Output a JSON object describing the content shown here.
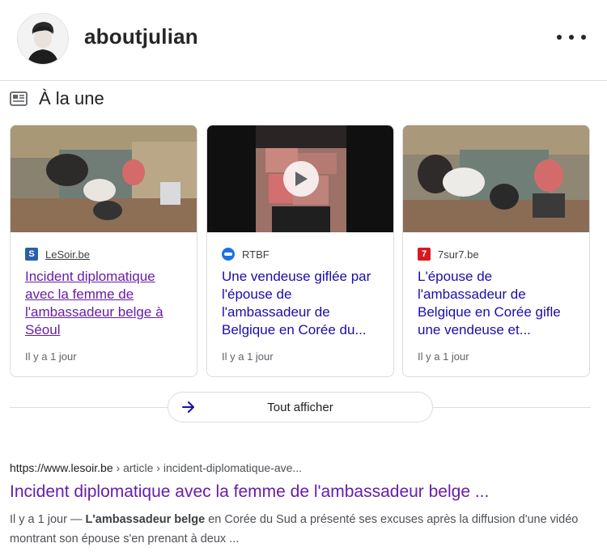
{
  "post": {
    "username": "aboutjulian",
    "avatar_icon": "person-avatar",
    "more_icon": "more-horizontal-icon"
  },
  "top_stories": {
    "title": "À la une",
    "icon": "newspaper-icon",
    "cards": [
      {
        "source": "LeSoir.be",
        "logo_letter": "S",
        "logo_color": "#2d5fa8",
        "headline": "Incident diplomatique avec la femme de l'ambassadeur belge à Séoul",
        "time": "Il y a 1 jour",
        "visited": true,
        "video": false
      },
      {
        "source": "RTBF",
        "logo_letter": "",
        "logo_color": "#1a73e8",
        "headline": "Une vendeuse giflée par l'épouse de l'ambassadeur de Belgique en Corée du...",
        "time": "Il y a 1 jour",
        "visited": false,
        "video": true
      },
      {
        "source": "7sur7.be",
        "logo_letter": "7",
        "logo_color": "#d71a21",
        "headline": "L'épouse de l'ambassadeur de Belgique en Corée gifle une vendeuse et...",
        "time": "Il y a 1 jour",
        "visited": false,
        "video": false
      }
    ],
    "show_all_label": "Tout afficher"
  },
  "result": {
    "url_domain": "https://www.lesoir.be",
    "url_crumbs": " › article › incident-diplomatique-ave...",
    "title": "Incident diplomatique avec la femme de l'ambassadeur belge ...",
    "snippet_time": "Il y a 1 jour — ",
    "snippet_bold": "L'ambassadeur belge",
    "snippet_rest": " en Corée du Sud a présenté ses excuses après la diffusion d'une vidéo montrant son épouse s'en prenant à deux ..."
  },
  "colors": {
    "link": "#1a0dab",
    "visited": "#681da8",
    "border": "#dadce0"
  }
}
